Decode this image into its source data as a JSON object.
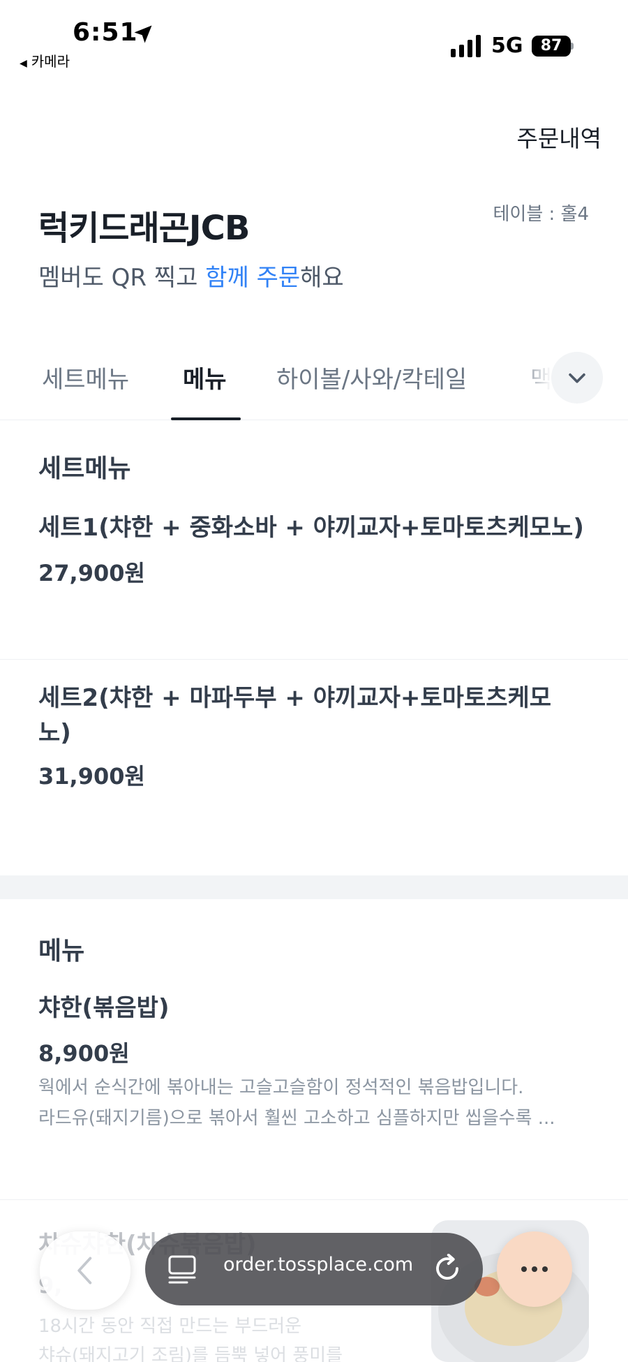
{
  "status_bar": {
    "time": "6:51",
    "back_app": "카메라",
    "network": "5G",
    "battery": "87"
  },
  "header": {
    "order_history": "주문내역",
    "store_name": "럭키드래곤JCB",
    "table": "테이블 : 홀4",
    "subtitle_pre": "멤버도 QR 찍고 ",
    "subtitle_accent": "함께 주문",
    "subtitle_post": "해요"
  },
  "tabs": [
    {
      "label": "세트메뉴"
    },
    {
      "label": "메뉴"
    },
    {
      "label": "하이볼/사와/칵테일"
    },
    {
      "label": "맥"
    }
  ],
  "sections": {
    "set_menu": {
      "title": "세트메뉴",
      "items": [
        {
          "name": "세트1(챠한 + 중화소바 + 야끼교자+토마토츠케모노)",
          "price": "27,900원"
        },
        {
          "name_line1": "세트2(챠한 + 마파두부 + 야끼교자+토마토츠케모",
          "name_line2": "노)",
          "price": "31,900원"
        }
      ]
    },
    "menu": {
      "title": "메뉴",
      "items": [
        {
          "name": "챠한(볶음밥)",
          "price": "8,900원",
          "desc_line1": "웍에서 순식간에 볶아내는 고슬고슬함이 정석적인 볶음밥입니다.",
          "desc_line2": "라드유(돼지기름)으로 볶아서 훨씬 고소하고 심플하지만 씹을수록 ..."
        },
        {
          "name": "챠슈챠한(차슈볶음밥)",
          "price": "9,",
          "desc_line1": "18시간 동안 직접 만드는 부드러운",
          "desc_line2": "챠슈(돼지고기 조림)를 듬뿍 넣어 풍미를"
        }
      ]
    }
  },
  "browser": {
    "url": "order.tossplace.com"
  }
}
